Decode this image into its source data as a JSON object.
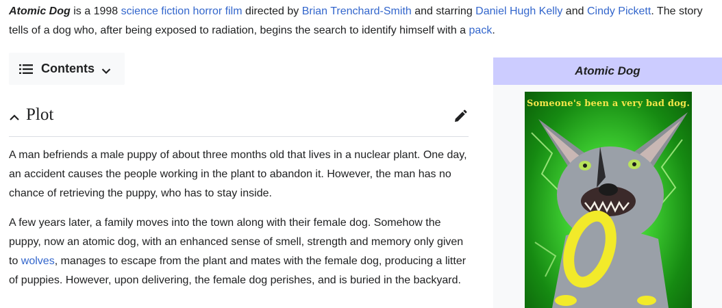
{
  "lead": {
    "title_bold": "Atomic Dog",
    "t1": " is a 1998 ",
    "link_genre": "science fiction horror film",
    "t2": " directed by ",
    "link_director": "Brian Trenchard-Smith",
    "t3": " and starring ",
    "link_actor1": "Daniel Hugh Kelly",
    "t4": " and ",
    "link_actor2": "Cindy Pickett",
    "t5": ". The story tells of a dog who, after being exposed to radiation, begins the search to identify himself with a ",
    "link_pack": "pack",
    "t6": "."
  },
  "toc": {
    "label": "Contents"
  },
  "section": {
    "title": "Plot"
  },
  "plot": {
    "p1": "A man befriends a male puppy of about three months old that lives in a nuclear plant. One day, an accident causes the people working in the plant to abandon it. However, the man has no chance of retrieving the puppy, who has to stay inside.",
    "p2_a": "A few years later, a family moves into the town along with their female dog. Somehow the puppy, now an atomic dog, with an enhanced sense of smell, strength and memory only given to ",
    "p2_link": "wolves",
    "p2_b": ", manages to escape from the plant and mates with the female dog, producing a litter of puppies. However, upon delivering, the female dog perishes, and is buried in the backyard."
  },
  "infobox": {
    "title": "Atomic Dog",
    "poster_tagline": "Someone's been a very bad dog."
  },
  "icons": {
    "toc": "list-icon",
    "chevron": "chevron-down-icon",
    "collapse": "chevron-up-icon",
    "edit": "pencil-icon"
  },
  "colors": {
    "link": "#3366cc",
    "infobox_header": "#ccccff",
    "text": "#202122"
  }
}
